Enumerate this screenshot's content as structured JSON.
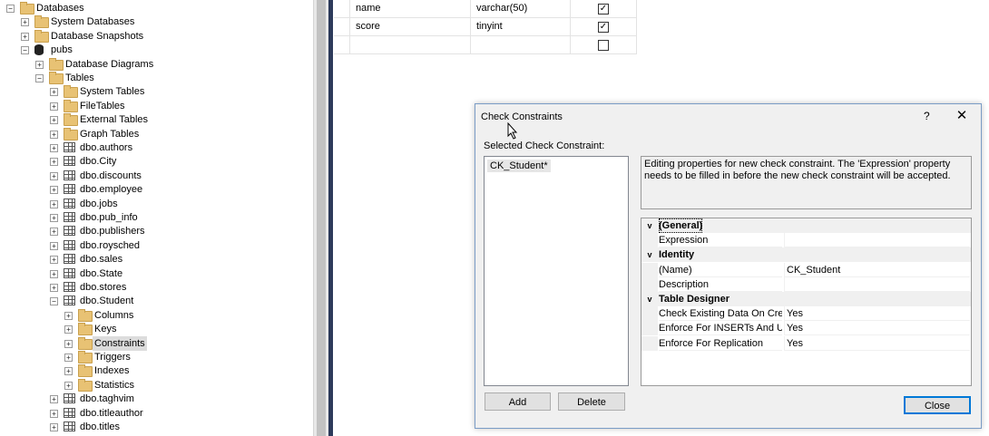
{
  "tree": {
    "items": [
      {
        "label": "Databases",
        "level": 0,
        "expander": "−",
        "icon": "folder-icon"
      },
      {
        "label": "System Databases",
        "level": 1,
        "expander": "+",
        "icon": "folder-icon"
      },
      {
        "label": "Database Snapshots",
        "level": 1,
        "expander": "+",
        "icon": "folder-icon"
      },
      {
        "label": "pubs",
        "level": 1,
        "expander": "−",
        "icon": "database-icon"
      },
      {
        "label": "Database Diagrams",
        "level": 2,
        "expander": "+",
        "icon": "folder-icon"
      },
      {
        "label": "Tables",
        "level": 2,
        "expander": "−",
        "icon": "folder-icon"
      },
      {
        "label": "System Tables",
        "level": 3,
        "expander": "+",
        "icon": "folder-icon"
      },
      {
        "label": "FileTables",
        "level": 3,
        "expander": "+",
        "icon": "folder-icon"
      },
      {
        "label": "External Tables",
        "level": 3,
        "expander": "+",
        "icon": "folder-icon"
      },
      {
        "label": "Graph Tables",
        "level": 3,
        "expander": "+",
        "icon": "folder-icon"
      },
      {
        "label": "dbo.authors",
        "level": 3,
        "expander": "+",
        "icon": "table-icon"
      },
      {
        "label": "dbo.City",
        "level": 3,
        "expander": "+",
        "icon": "table-icon"
      },
      {
        "label": "dbo.discounts",
        "level": 3,
        "expander": "+",
        "icon": "table-icon"
      },
      {
        "label": "dbo.employee",
        "level": 3,
        "expander": "+",
        "icon": "table-icon"
      },
      {
        "label": "dbo.jobs",
        "level": 3,
        "expander": "+",
        "icon": "table-icon"
      },
      {
        "label": "dbo.pub_info",
        "level": 3,
        "expander": "+",
        "icon": "table-icon"
      },
      {
        "label": "dbo.publishers",
        "level": 3,
        "expander": "+",
        "icon": "table-icon"
      },
      {
        "label": "dbo.roysched",
        "level": 3,
        "expander": "+",
        "icon": "table-icon"
      },
      {
        "label": "dbo.sales",
        "level": 3,
        "expander": "+",
        "icon": "table-icon"
      },
      {
        "label": "dbo.State",
        "level": 3,
        "expander": "+",
        "icon": "table-icon"
      },
      {
        "label": "dbo.stores",
        "level": 3,
        "expander": "+",
        "icon": "table-icon"
      },
      {
        "label": "dbo.Student",
        "level": 3,
        "expander": "−",
        "icon": "table-icon"
      },
      {
        "label": "Columns",
        "level": 4,
        "expander": "+",
        "icon": "folder-icon"
      },
      {
        "label": "Keys",
        "level": 4,
        "expander": "+",
        "icon": "folder-icon"
      },
      {
        "label": "Constraints",
        "level": 4,
        "expander": "+",
        "icon": "folder-icon",
        "selected": true
      },
      {
        "label": "Triggers",
        "level": 4,
        "expander": "+",
        "icon": "folder-icon"
      },
      {
        "label": "Indexes",
        "level": 4,
        "expander": "+",
        "icon": "folder-icon"
      },
      {
        "label": "Statistics",
        "level": 4,
        "expander": "+",
        "icon": "folder-icon"
      },
      {
        "label": "dbo.taghvim",
        "level": 3,
        "expander": "+",
        "icon": "table-icon"
      },
      {
        "label": "dbo.titleauthor",
        "level": 3,
        "expander": "+",
        "icon": "table-icon"
      },
      {
        "label": "dbo.titles",
        "level": 3,
        "expander": "+",
        "icon": "table-icon"
      }
    ]
  },
  "columns_grid": {
    "rows": [
      {
        "name": "name",
        "type": "varchar(50)",
        "allow_nulls": true
      },
      {
        "name": "score",
        "type": "tinyint",
        "allow_nulls": true
      },
      {
        "name": "",
        "type": "",
        "allow_nulls": false
      }
    ]
  },
  "dialog": {
    "title": "Check Constraints",
    "help": "?",
    "close_glyph": "✕",
    "selected_label": "Selected Check Constraint:",
    "list_item": "CK_Student*",
    "info": "Editing properties for new check constraint.  The 'Expression' property needs to be filled in before the new check constraint will be accepted.",
    "properties": [
      {
        "kind": "category",
        "label": "(General)",
        "toggle": "v",
        "focused": true
      },
      {
        "kind": "prop",
        "label": "Expression",
        "value": ""
      },
      {
        "kind": "category",
        "label": "Identity",
        "toggle": "v"
      },
      {
        "kind": "prop",
        "label": "(Name)",
        "value": "CK_Student"
      },
      {
        "kind": "prop",
        "label": "Description",
        "value": ""
      },
      {
        "kind": "category",
        "label": "Table Designer",
        "toggle": "v"
      },
      {
        "kind": "prop",
        "label": "Check Existing Data On Creati",
        "value": "Yes"
      },
      {
        "kind": "prop",
        "label": "Enforce For INSERTs And UPD",
        "value": "Yes"
      },
      {
        "kind": "prop",
        "label": "Enforce For Replication",
        "value": "Yes"
      }
    ],
    "add_label": "Add",
    "delete_label": "Delete",
    "close_label": "Close"
  },
  "colors": {
    "accent": "#0078d7",
    "folder": "#e8c274",
    "splitter": "#2d3a5a"
  }
}
